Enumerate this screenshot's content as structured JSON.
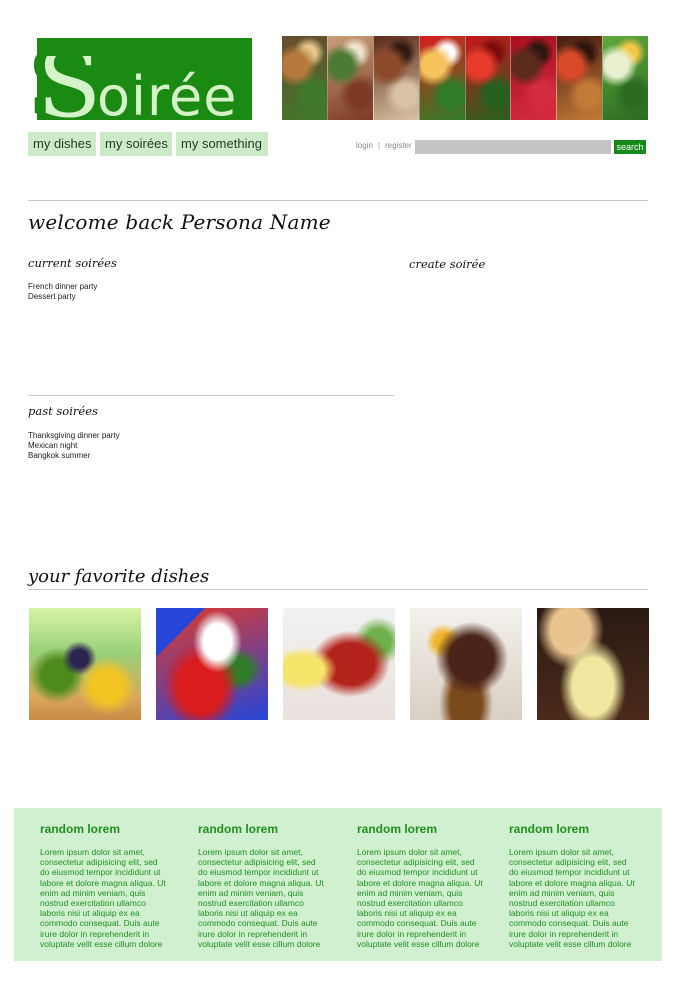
{
  "logo": {
    "text": "Soirée",
    "colors": {
      "green": "#1b8a12",
      "light": "#d5f3c9"
    }
  },
  "banner": {
    "tiles": [
      {
        "icon": "burger-photo",
        "colors": [
          "#6a4a2e",
          "#b77a3c",
          "#3f7a2a",
          "#e6c48a"
        ]
      },
      {
        "icon": "herb-steak-photo",
        "colors": [
          "#c9a07a",
          "#4d7a34",
          "#7c3a25",
          "#f0e3cf"
        ]
      },
      {
        "icon": "grilled-meat-photo",
        "colors": [
          "#5a2a19",
          "#8d4a2a",
          "#d9c2a5",
          "#2f1b12"
        ]
      },
      {
        "icon": "tomato-cheese-photo",
        "colors": [
          "#d81e1e",
          "#f6c35a",
          "#2f7d27",
          "#ffffff"
        ]
      },
      {
        "icon": "tomatoes-vine-photo",
        "colors": [
          "#c6161a",
          "#e83b2c",
          "#26601f",
          "#7a0b0b"
        ]
      },
      {
        "icon": "raspberry-cake-photo",
        "colors": [
          "#a8101e",
          "#5b2b1d",
          "#d42c3f",
          "#2c1610"
        ]
      },
      {
        "icon": "bruschetta-photo",
        "colors": [
          "#4a1c10",
          "#d94a2a",
          "#c27a37",
          "#2b140d"
        ]
      },
      {
        "icon": "salad-photo",
        "colors": [
          "#5ea83c",
          "#e8f0d0",
          "#2d6b22",
          "#f5c542"
        ]
      }
    ]
  },
  "nav": {
    "items": [
      "my dishes",
      "my soirées",
      "my something"
    ]
  },
  "auth": {
    "login": "login",
    "separator": "|",
    "register": "register"
  },
  "search": {
    "placeholder": "",
    "button": "search"
  },
  "main": {
    "welcome": "welcome back Persona Name",
    "current": {
      "heading": "current soirées",
      "items": [
        "French dinner party",
        "Dessert party"
      ]
    },
    "create": {
      "heading": "create soirée"
    },
    "past": {
      "heading": "past soirées",
      "items": [
        "Thanksgiving dinner party",
        "Mexican night",
        "Bangkok summer"
      ]
    }
  },
  "favorites": {
    "heading": "your favorite dishes",
    "dishes": [
      {
        "icon": "fruit-tart-photo"
      },
      {
        "icon": "caprese-skewer-photo"
      },
      {
        "icon": "grilled-sausage-photo"
      },
      {
        "icon": "steak-potatoes-photo"
      },
      {
        "icon": "soup-bread-photo"
      }
    ]
  },
  "footer": {
    "columns": [
      {
        "title": "random lorem",
        "text": "Lorem ipsum dolor sit amet, consectetur adipisicing elit, sed do eiusmod tempor incididunt ut labore et dolore magna aliqua. Ut enim ad minim veniam, quis nostrud exercitation ullamco laboris nisi ut aliquip ex ea commodo consequat. Duis aute irure dolor in reprehenderit in voluptate velit esse cillum dolore"
      },
      {
        "title": "random lorem",
        "text": "Lorem ipsum dolor sit amet, consectetur adipisicing elit, sed do eiusmod tempor incididunt ut labore et dolore magna aliqua. Ut enim ad minim veniam, quis nostrud exercitation ullamco laboris nisi ut aliquip ex ea commodo consequat. Duis aute irure dolor in reprehenderit in voluptate velit esse cillum dolore"
      },
      {
        "title": "random lorem",
        "text": "Lorem ipsum dolor sit amet, consectetur adipisicing elit, sed do eiusmod tempor incididunt ut labore et dolore magna aliqua. Ut enim ad minim veniam, quis nostrud exercitation ullamco laboris nisi ut aliquip ex ea commodo consequat. Duis aute irure dolor in reprehenderit in voluptate velit esse cillum dolore"
      },
      {
        "title": "random lorem",
        "text": "Lorem ipsum dolor sit amet, consectetur adipisicing elit, sed do eiusmod tempor incididunt ut labore et dolore magna aliqua. Ut enim ad minim veniam, quis nostrud exercitation ullamco laboris nisi ut aliquip ex ea commodo consequat. Duis aute irure dolor in reprehenderit in voluptate velit esse cillum dolore"
      }
    ]
  }
}
